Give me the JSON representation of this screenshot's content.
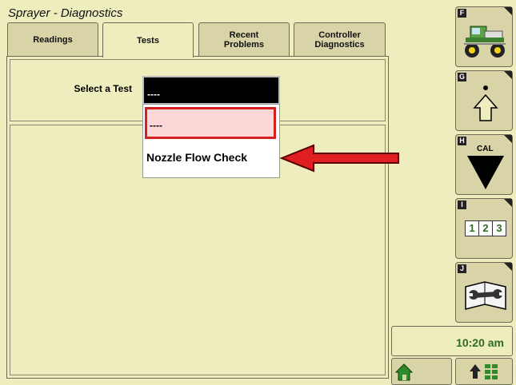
{
  "header": {
    "title": "Sprayer - Diagnostics"
  },
  "tabs": [
    {
      "label": "Readings"
    },
    {
      "label": "Tests"
    },
    {
      "label": "Recent\nProblems"
    },
    {
      "label": "Controller\nDiagnostics"
    }
  ],
  "test_select": {
    "label": "Select a Test",
    "value": "----",
    "options": [
      "----",
      "Nozzle Flow Check"
    ]
  },
  "softkeys": [
    {
      "letter": "F",
      "icon": "sprayer-machine-icon"
    },
    {
      "letter": "G",
      "icon": "up-arrow-icon"
    },
    {
      "letter": "H",
      "icon": "calibrate-icon",
      "text": "CAL"
    },
    {
      "letter": "I",
      "icon": "numeric-entry-icon",
      "digits": [
        "1",
        "2",
        "3"
      ]
    },
    {
      "letter": "J",
      "icon": "wrench-manual-icon"
    }
  ],
  "status": {
    "clock": "10:20 am"
  },
  "colors": {
    "background": "#ededbe",
    "button": "#d9d4a8",
    "highlight": "#d42020",
    "clock_text": "#2f6b22"
  }
}
